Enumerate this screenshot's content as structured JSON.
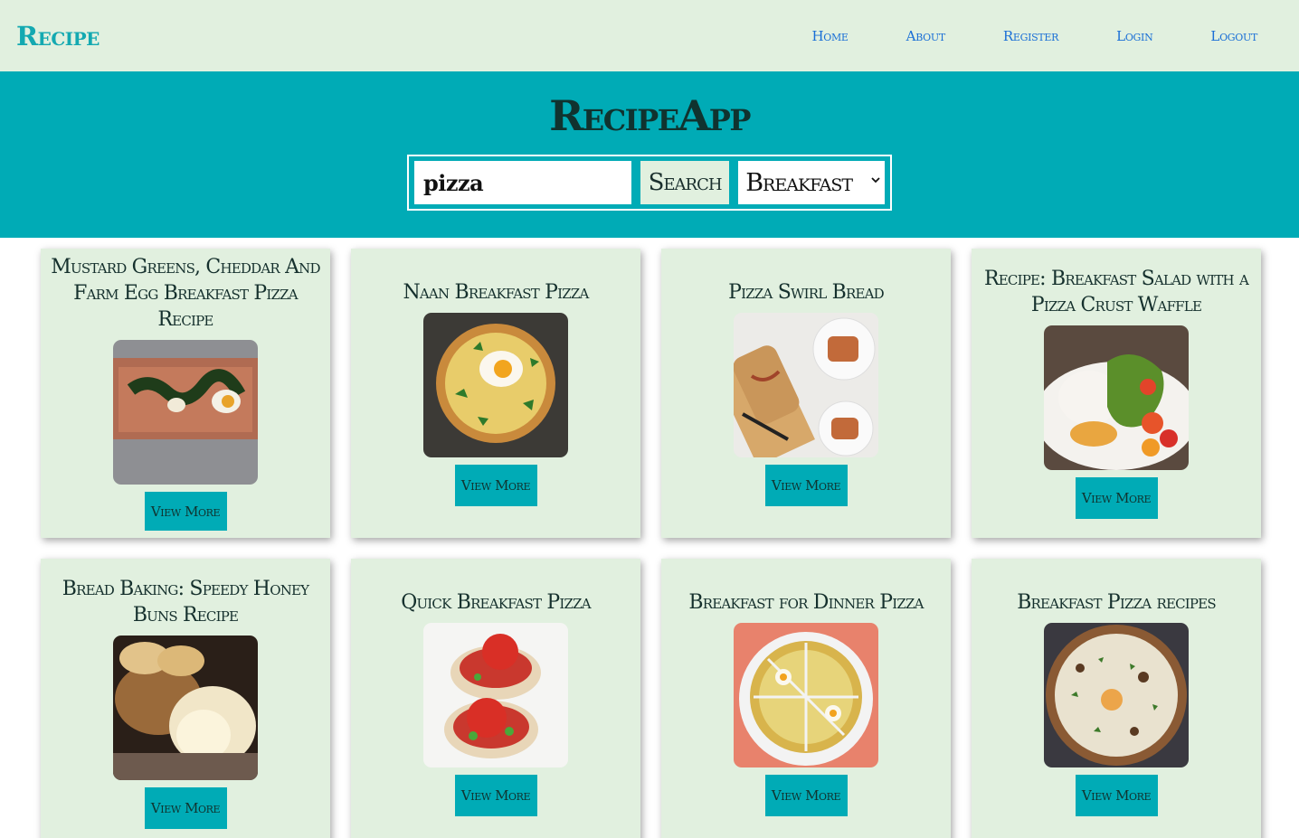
{
  "navbar": {
    "brand": "Recipe",
    "links": [
      "Home",
      "About",
      "Register",
      "Login",
      "Logout"
    ]
  },
  "hero": {
    "title": "RecipeApp",
    "search_value": "pizza",
    "search_button": "Search",
    "category_selected": "Breakfast"
  },
  "recipes": [
    {
      "title": "Mustard Greens, Cheddar And Farm Egg Breakfast Pizza Recipe",
      "button": "View More",
      "image": "pizza-greens-egg"
    },
    {
      "title": "Naan Breakfast Pizza",
      "button": "View More",
      "image": "naan-pizza-egg"
    },
    {
      "title": "Pizza Swirl Bread",
      "button": "View More",
      "image": "swirl-bread"
    },
    {
      "title": "Recipe: Breakfast Salad with a Pizza Crust Waffle",
      "button": "View More",
      "image": "salad-waffle"
    },
    {
      "title": "Bread Baking: Speedy Honey Buns Recipe",
      "button": "View More",
      "image": "honey-buns"
    },
    {
      "title": "Quick Breakfast Pizza",
      "button": "View More",
      "image": "tomato-pizza"
    },
    {
      "title": "Breakfast for Dinner Pizza",
      "button": "View More",
      "image": "dinner-pizza"
    },
    {
      "title": "Breakfast Pizza recipes",
      "button": "View More",
      "image": "herb-pizza"
    }
  ],
  "colors": {
    "navbar_bg": "#e1f0df",
    "hero_bg": "#00abb6",
    "brand": "#14a9b1",
    "nav_link": "#1a6fd6",
    "card_bg": "#e1f0df",
    "button_bg": "#00abb6"
  }
}
